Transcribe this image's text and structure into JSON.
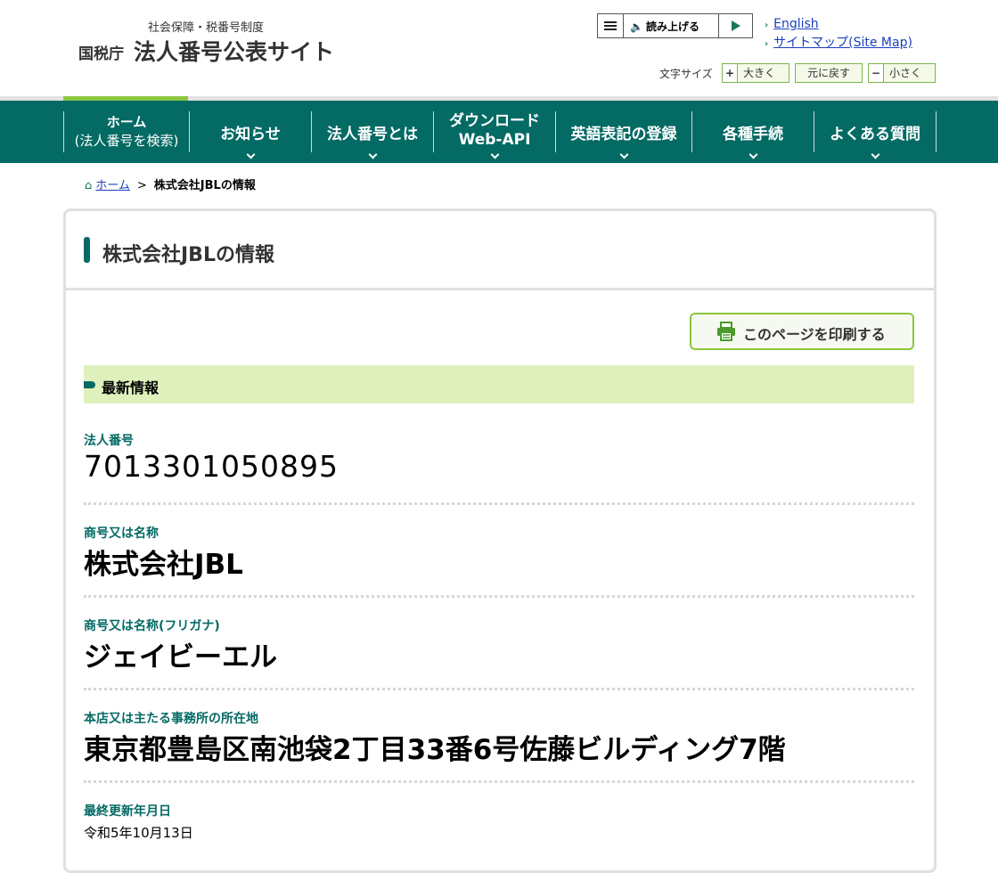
{
  "header": {
    "logo_subtitle": "社会保障・税番号制度",
    "logo_agency": "国税庁",
    "logo_title": "法人番号公表サイト",
    "readaloud_label": "読み上げる",
    "links": [
      "English",
      "サイトマップ(Site Map)"
    ],
    "font_size": {
      "label": "文字サイズ",
      "larger": "大きく",
      "reset": "元に戻す",
      "smaller": "小さく"
    }
  },
  "nav": {
    "items": [
      {
        "line1": "ホーム",
        "line2": "(法人番号を検索)"
      },
      {
        "line1": "お知らせ"
      },
      {
        "line1": "法人番号とは"
      },
      {
        "line1": "ダウンロード",
        "line2": "Web-API"
      },
      {
        "line1": "英語表記の登録"
      },
      {
        "line1": "各種手続"
      },
      {
        "line1": "よくある質問"
      }
    ]
  },
  "breadcrumb": {
    "home": "ホーム",
    "separator": ">",
    "current": "株式会社JBLの情報"
  },
  "page": {
    "title": "株式会社JBLの情報",
    "print_button": "このページを印刷する",
    "section_title": "最新情報",
    "fields": [
      {
        "label": "法人番号",
        "value": "7013301050895"
      },
      {
        "label": "商号又は名称",
        "value": "株式会社JBL"
      },
      {
        "label": "商号又は名称(フリガナ)",
        "value": "ジェイビーエル"
      },
      {
        "label": "本店又は主たる事務所の所在地",
        "value": "東京都豊島区南池袋2丁目33番6号佐藤ビルディング7階"
      },
      {
        "label": "最終更新年月日",
        "value": "令和5年10月13日"
      }
    ]
  },
  "colors": {
    "brand_green": "#046a64",
    "accent_green": "#8cc63f",
    "section_bg": "#e0f0bd",
    "link": "#1a3fbf"
  }
}
